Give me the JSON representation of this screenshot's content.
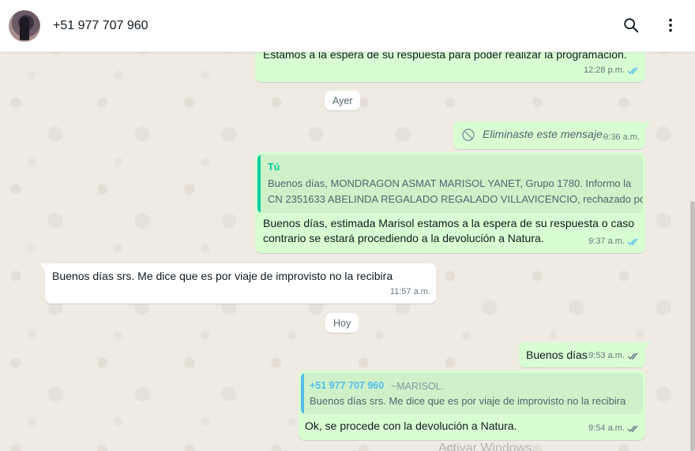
{
  "header": {
    "contact_name": "+51 977 707 960"
  },
  "messages": {
    "m1": {
      "text": "Estamos a la espera de su respuesta para poder realizar la programación.",
      "time": "12:28 p.m."
    },
    "date_ayer": "Ayer",
    "m2": {
      "text": "Eliminaste este mensaje.",
      "time": "9:36 a.m."
    },
    "m3": {
      "quote_author": "Tú",
      "quote_line1": "Buenos días, MONDRAGON ASMAT MARISOL YANET, Grupo 1780. Informo la",
      "quote_line2": "CN 2351633 ABELINDA REGALADO REGALADO VILLAVICENCIO, rechazado po...",
      "line1": "Buenos días, estimada Marisol estamos a la espera de su respuesta o caso",
      "line2": "contrario se estará procediendo a la devolución a Natura.",
      "time": "9:37 a.m."
    },
    "m4": {
      "text": "Buenos días  srs. Me dice que es por viaje  de improvisto  no la recibira",
      "time": "11:57 a.m."
    },
    "date_hoy": "Hoy",
    "m5": {
      "text": "Buenos días",
      "time": "9:53 a.m."
    },
    "m6": {
      "quote_author": "+51 977 707 960",
      "quote_pushname": "~MARISOL.",
      "quote_text": "Buenos días  srs. Me dice que es por viaje  de improvisto  no la recibira",
      "text": "Ok, se procede con la devolución a Natura.",
      "time": "9:54 a.m."
    }
  },
  "watermark": "Activar Windows",
  "colors": {
    "outgoing": "#d9fdd3",
    "incoming": "#ffffff",
    "read_tick": "#53bdeb",
    "sent_tick": "#667781",
    "you_quote": "#06cf9c",
    "contact_quote": "#53bdeb"
  }
}
